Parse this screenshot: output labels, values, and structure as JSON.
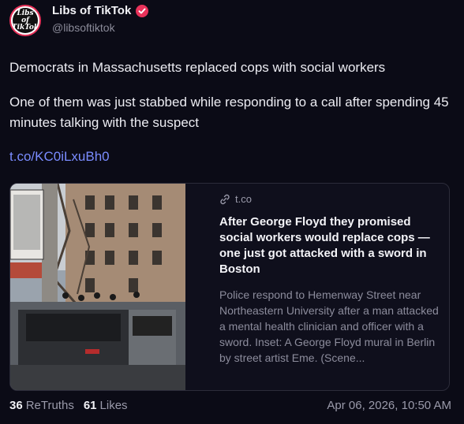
{
  "author": {
    "display_name": "Libs of TikTok",
    "handle": "@libsoftiktok",
    "avatar_line1": "Libs of",
    "avatar_line2": "TikTok"
  },
  "tweet": {
    "paragraph1": "Democrats in Massachusetts replaced cops with social workers",
    "paragraph2": "One of them was just stabbed while responding to a call after spending 45 minutes talking with the suspect",
    "link": "t.co/KC0iLxuBh0"
  },
  "card": {
    "domain": "t.co",
    "title": "After George Floyd they promised social workers would replace cops — one just got attacked with a sword in Boston",
    "description": "Police respond to Hemenway Street near Northeastern University after a man attacked a mental health clinician and officer with a sword. Inset: A George Floyd mural in Berlin by street artist Eme. (Scene..."
  },
  "stats": {
    "retweets_count": "36",
    "retweets_label": "ReTruths",
    "likes_count": "61",
    "likes_label": "Likes",
    "timestamp": "Apr 06, 2026, 10:50 AM"
  },
  "colors": {
    "background": "#0b0b16",
    "link": "#7a8cff",
    "verified_badge": "#e8325a"
  }
}
